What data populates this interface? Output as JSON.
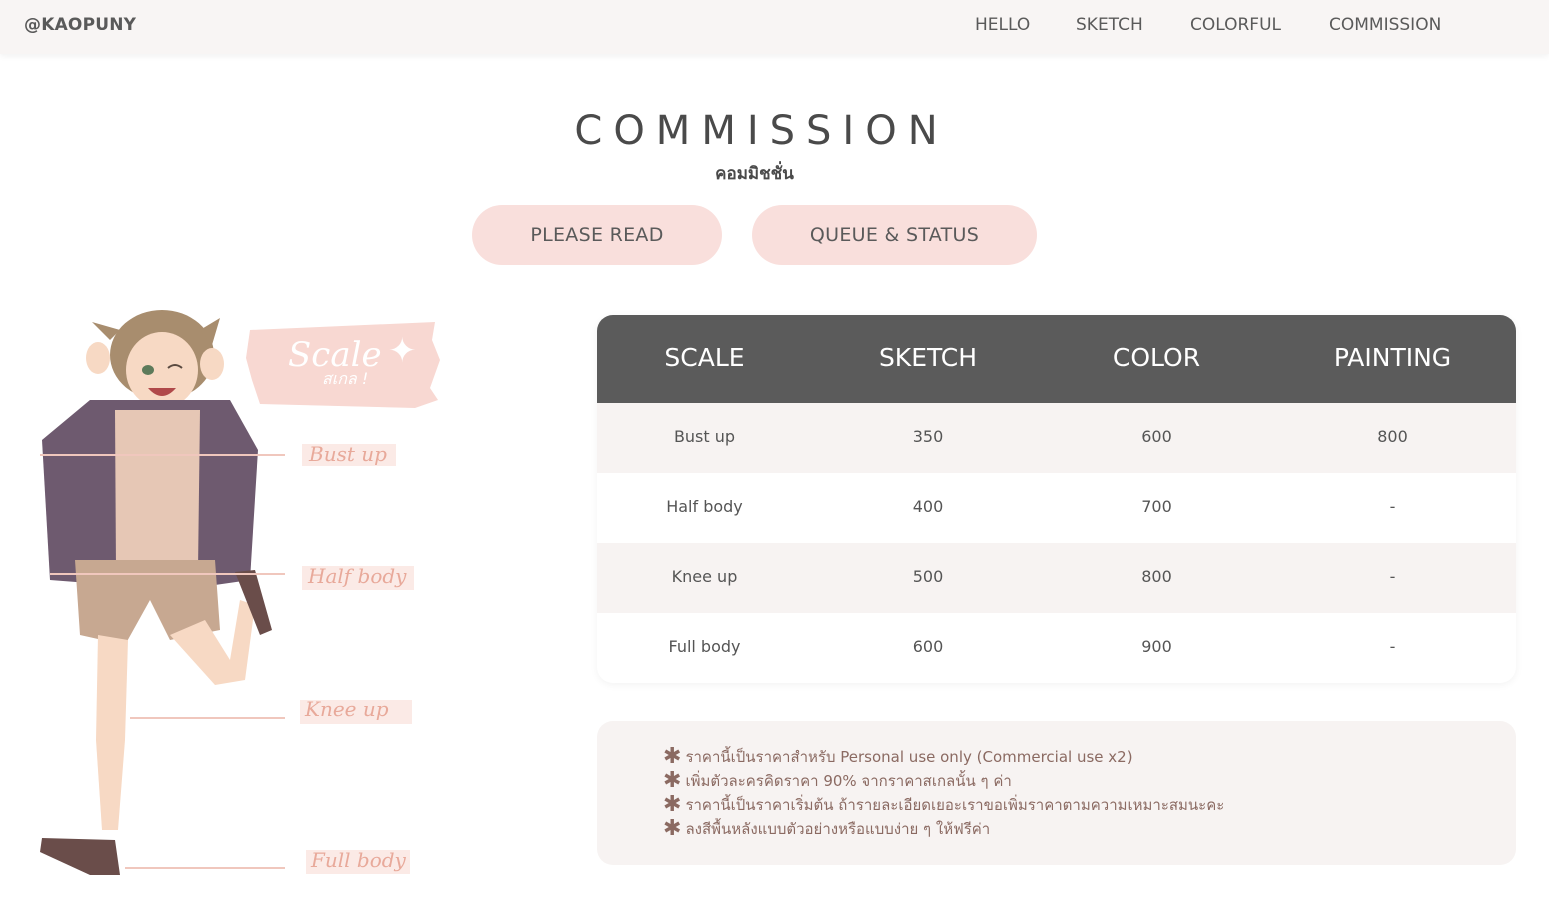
{
  "brand": "@KAOPUNY",
  "nav": [
    {
      "label": "HELLO"
    },
    {
      "label": "SKETCH"
    },
    {
      "label": "COLORFUL"
    },
    {
      "label": "COMMISSION"
    }
  ],
  "page": {
    "title": "COMMISSION",
    "subtitle": "คอมมิชชั่น"
  },
  "buttons": {
    "please_read": "PLEASE READ",
    "queue_status": "QUEUE & STATUS"
  },
  "illustration": {
    "scale_label": "Scale",
    "scale_label_th": "สเกล !",
    "markers": [
      "Bust up",
      "Half body",
      "Knee up",
      "Full body"
    ]
  },
  "pricing": {
    "headers": [
      "SCALE",
      "SKETCH",
      "COLOR",
      "PAINTING"
    ],
    "rows": [
      [
        "Bust up",
        "350",
        "600",
        "800"
      ],
      [
        "Half body",
        "400",
        "700",
        "-"
      ],
      [
        "Knee up",
        "500",
        "800",
        "-"
      ],
      [
        "Full body",
        "600",
        "900",
        "-"
      ]
    ]
  },
  "notes": [
    "ราคานี้เป็นราคาสำหรับ Personal use only (Commercial use x2)",
    "เพิ่มตัวละครคิดราคา 90% จากราคาสเกลนั้น ๆ ค่า",
    "ราคานี้เป็นราคาเริ่มต้น ถ้ารายละเอียดเยอะเราขอเพิ่มราคาตามความเหมาะสมนะคะ",
    "ลงสีพื้นหลังแบบตัวอย่างหรือแบบง่าย ๆ ให้ฟรีค่า"
  ],
  "colors": {
    "nav_bg": "#f8f5f4",
    "pill_bg": "#f9dfdc",
    "table_header_bg": "#5b5b5b",
    "row_alt_bg": "#f7f3f2",
    "note_text": "#8b6a62",
    "marker_text": "#e8a99a"
  }
}
